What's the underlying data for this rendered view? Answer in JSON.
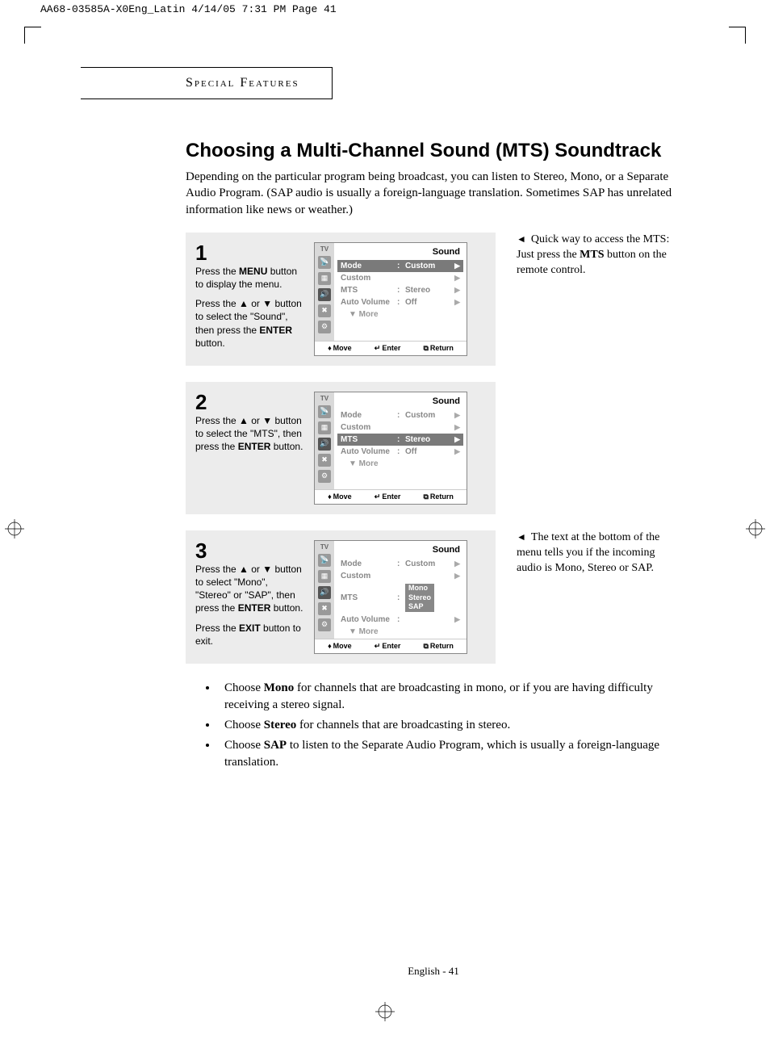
{
  "meta": {
    "slug": "AA68-03585A-X0Eng_Latin  4/14/05  7:31 PM  Page 41"
  },
  "section_header": "Special Features",
  "title": "Choosing a Multi-Channel Sound (MTS) Soundtrack",
  "intro": "Depending on the particular program being broadcast, you can listen to Stereo, Mono, or a Separate Audio Program. (SAP audio is usually a foreign-language translation. Sometimes SAP has unrelated information like news or weather.)",
  "steps": {
    "s1": {
      "num": "1",
      "p1a": "Press the ",
      "p1b": "MENU",
      "p1c": " button to display the menu.",
      "p2a": "Press the ▲ or ▼ button to select the \"Sound\", then press the ",
      "p2b": "ENTER",
      "p2c": " button."
    },
    "s2": {
      "num": "2",
      "p1a": "Press the ▲ or ▼ button to select the \"MTS\", then press the ",
      "p1b": "ENTER",
      "p1c": " button."
    },
    "s3": {
      "num": "3",
      "p1a": "Press the ▲ or ▼ button to select \"Mono\", \"Stereo\" or \"SAP\", then press the ",
      "p1b": "ENTER",
      "p1c": " button.",
      "p2a": "Press the ",
      "p2b": "EXIT",
      "p2c": " button to exit."
    }
  },
  "osd": {
    "tv": "TV",
    "title": "Sound",
    "mode_l": "Mode",
    "mode_v": "Custom",
    "custom_l": "Custom",
    "mts_l": "MTS",
    "mts_v": "Stereo",
    "av_l": "Auto Volume",
    "av_v": "Off",
    "more": "▼ More",
    "footer": {
      "move": "Move",
      "enter": "Enter",
      "return": "Return"
    },
    "popup": {
      "mono": "Mono",
      "stereo": "Stereo",
      "sap": "SAP"
    }
  },
  "notes": {
    "n1a": "Quick way to access the MTS: Just press the ",
    "n1b": "MTS",
    "n1c": " button on the remote control.",
    "n2": "The text at the bottom of the menu tells you if the incoming audio is Mono, Stereo or SAP."
  },
  "bullets": {
    "b1a": "Choose ",
    "b1b": "Mono",
    "b1c": " for channels that are broadcasting in mono, or if you are having difficulty receiving a stereo signal.",
    "b2a": "Choose ",
    "b2b": "Stereo",
    "b2c": " for channels that are broadcasting in stereo.",
    "b3a": "Choose ",
    "b3b": "SAP",
    "b3c": " to listen to the Separate Audio Program, which is usually a foreign-language translation."
  },
  "footer": "English - 41"
}
